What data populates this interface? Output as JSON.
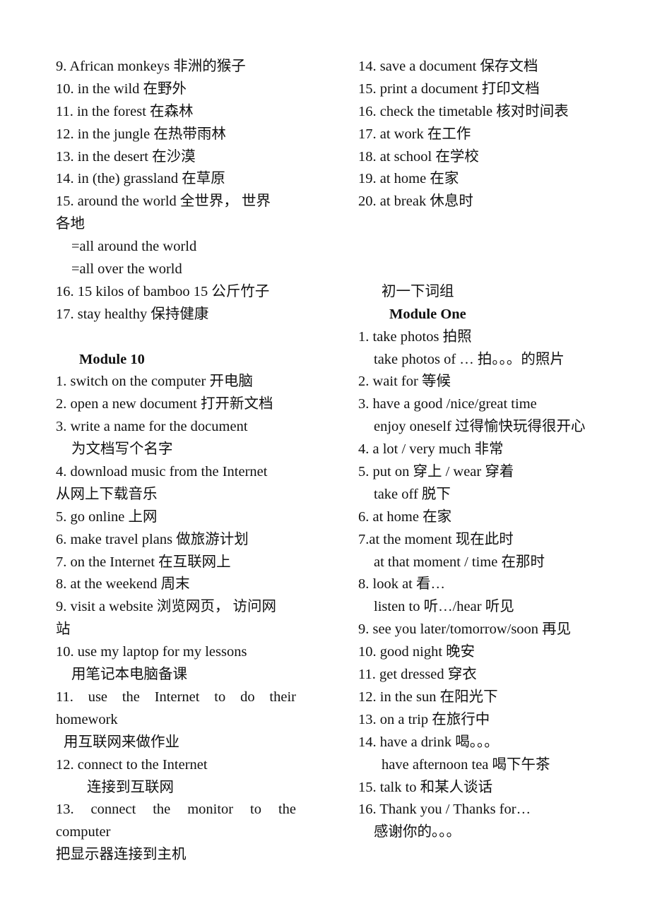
{
  "left_column": [
    {
      "text": "9. African monkeys  非洲的猴子",
      "indent": 0
    },
    {
      "text": "10. in the wild  在野外",
      "indent": 0
    },
    {
      "text": "11. in the forest  在森林",
      "indent": 0
    },
    {
      "text": "12. in the jungle  在热带雨林",
      "indent": 0
    },
    {
      "text": "13. in the desert  在沙漠",
      "indent": 0
    },
    {
      "text": "14. in (the) grassland  在草原",
      "indent": 0
    },
    {
      "text": "15. around the world  全世界， 世界",
      "indent": 0
    },
    {
      "text": "各地",
      "indent": 0
    },
    {
      "text": "=all around the world",
      "indent": 22
    },
    {
      "text": "=all over the world",
      "indent": 22
    },
    {
      "text": "16. 15 kilos of bamboo 15 公斤竹子",
      "indent": 0
    },
    {
      "text": "17. stay healthy  保持健康",
      "indent": 0
    },
    {
      "text": "",
      "indent": 0
    },
    {
      "text": "Module 10",
      "indent": 33,
      "heading": true
    },
    {
      "text": "1. switch on the computer  开电脑",
      "indent": 0
    },
    {
      "text": "2. open a new document 打开新文档",
      "indent": 0
    },
    {
      "text": "3. write a name for the document",
      "indent": 0
    },
    {
      "text": "为文档写个名字",
      "indent": 22
    },
    {
      "text": "4. download music from the Internet",
      "indent": 0
    },
    {
      "text": "从网上下载音乐",
      "indent": 0
    },
    {
      "text": "5. go online  上网",
      "indent": 0
    },
    {
      "text": "6. make travel plans  做旅游计划",
      "indent": 0
    },
    {
      "text": "7. on the Internet  在互联网上",
      "indent": 0
    },
    {
      "text": "8. at the weekend  周末",
      "indent": 0
    },
    {
      "text": "9. visit a website  浏览网页， 访问网",
      "indent": 0
    },
    {
      "text": "站",
      "indent": 0
    },
    {
      "text": "10. use my laptop for my lessons",
      "indent": 0
    },
    {
      "text": "用笔记本电脑备课",
      "indent": 22
    },
    {
      "text": "11. use the Internet to do their",
      "indent": 0,
      "justify": true
    },
    {
      "text": "homework",
      "indent": 0
    },
    {
      "text": "用互联网来做作业",
      "indent": 11
    },
    {
      "text": "12. connect to the Internet",
      "indent": 0
    },
    {
      "text": "连接到互联网",
      "indent": 44
    },
    {
      "text": "13. connect the monitor to the",
      "indent": 0,
      "justify": true
    },
    {
      "text": "computer",
      "indent": 0
    },
    {
      "text": "把显示器连接到主机",
      "indent": 0
    }
  ],
  "right_column": [
    {
      "text": "14. save a document  保存文档",
      "indent": 0
    },
    {
      "text": "15. print a document  打印文档",
      "indent": 0
    },
    {
      "text": "16. check the timetable  核对时间表",
      "indent": 0
    },
    {
      "text": "17. at work  在工作",
      "indent": 0
    },
    {
      "text": "18. at school  在学校",
      "indent": 0
    },
    {
      "text": "19. at home  在家",
      "indent": 0
    },
    {
      "text": "20. at break  休息时",
      "indent": 0
    },
    {
      "text": "",
      "indent": 0
    },
    {
      "text": "",
      "indent": 0
    },
    {
      "text": "",
      "indent": 0
    },
    {
      "text": "初一下词组",
      "indent": 33
    },
    {
      "text": "Module One",
      "indent": 44,
      "heading": true
    },
    {
      "text": "1. take photos  拍照",
      "indent": 0
    },
    {
      "text": "take photos of …  拍。。。的照片",
      "indent": 22
    },
    {
      "text": "2. wait for  等候",
      "indent": 0
    },
    {
      "text": "3. have a good /nice/great time",
      "indent": 0
    },
    {
      "text": "enjoy oneself 过得愉快玩得很开心",
      "indent": 22
    },
    {
      "text": "4. a lot / very much 非常",
      "indent": 0
    },
    {
      "text": "5. put on  穿上  / wear  穿着",
      "indent": 0
    },
    {
      "text": "take off  脱下",
      "indent": 22
    },
    {
      "text": "6. at home  在家",
      "indent": 0
    },
    {
      "text": "7.at the moment  现在此时",
      "indent": 0
    },
    {
      "text": "at that moment / time  在那时",
      "indent": 22
    },
    {
      "text": "8. look at  看…",
      "indent": 0
    },
    {
      "text": "listen to  听…/hear  听见",
      "indent": 22
    },
    {
      "text": "9. see you later/tomorrow/soon  再见",
      "indent": 0
    },
    {
      "text": "10. good night  晚安",
      "indent": 0
    },
    {
      "text": "11. get dressed  穿衣",
      "indent": 0
    },
    {
      "text": "12. in the sun 在阳光下",
      "indent": 0
    },
    {
      "text": "13. on a trip 在旅行中",
      "indent": 0
    },
    {
      "text": "14. have a drink  喝。。。",
      "indent": 0
    },
    {
      "text": "have afternoon tea  喝下午茶",
      "indent": 33
    },
    {
      "text": "15. talk to  和某人谈话",
      "indent": 0
    },
    {
      "text": "16. Thank you / Thanks for…",
      "indent": 0
    },
    {
      "text": "感谢你的。。。",
      "indent": 22
    }
  ]
}
